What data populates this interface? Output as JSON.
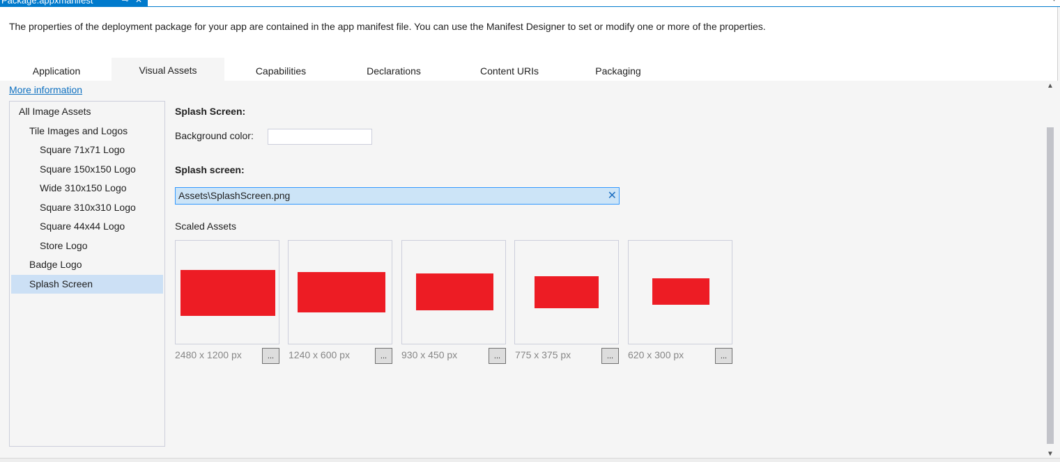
{
  "document_tab": {
    "title": "Package.appxmanifest",
    "pin_glyph": "⊸",
    "close_glyph": "✕"
  },
  "description": "The properties of the deployment package for your app are contained in the app manifest file. You can use the Manifest Designer to set or modify one or more of the properties.",
  "tabs": [
    {
      "label": "Application",
      "active": false
    },
    {
      "label": "Visual Assets",
      "active": true
    },
    {
      "label": "Capabilities",
      "active": false
    },
    {
      "label": "Declarations",
      "active": false
    },
    {
      "label": "Content URIs",
      "active": false
    },
    {
      "label": "Packaging",
      "active": false
    }
  ],
  "more_information": "More information",
  "tree": [
    {
      "label": "All Image Assets",
      "level": 0,
      "selected": false
    },
    {
      "label": "Tile Images and Logos",
      "level": 1,
      "selected": false
    },
    {
      "label": "Square 71x71 Logo",
      "level": 2,
      "selected": false
    },
    {
      "label": "Square 150x150 Logo",
      "level": 2,
      "selected": false
    },
    {
      "label": "Wide 310x150 Logo",
      "level": 2,
      "selected": false
    },
    {
      "label": "Square 310x310 Logo",
      "level": 2,
      "selected": false
    },
    {
      "label": "Square 44x44 Logo",
      "level": 2,
      "selected": false
    },
    {
      "label": "Store Logo",
      "level": 2,
      "selected": false
    },
    {
      "label": "Badge Logo",
      "level": 1,
      "selected": false
    },
    {
      "label": "Splash Screen",
      "level": 1,
      "selected": true
    }
  ],
  "splash": {
    "section_title": "Splash Screen:",
    "background_color_label": "Background color:",
    "background_color_value": "",
    "splash_screen_label": "Splash screen:",
    "path_value": "Assets\\SplashScreen.png",
    "clear_glyph": "✕",
    "scaled_assets_label": "Scaled Assets"
  },
  "scaled_assets": [
    {
      "size": "2480 x 1200 px",
      "button": "..."
    },
    {
      "size": "1240 x 600 px",
      "button": "..."
    },
    {
      "size": "930 x 450 px",
      "button": "..."
    },
    {
      "size": "775 x 375 px",
      "button": "..."
    },
    {
      "size": "620 x 300 px",
      "button": "..."
    }
  ],
  "colors": {
    "accent": "#007acc",
    "asset_fill": "#ed1c24",
    "selection": "#cce0f5",
    "link": "#0e70c0"
  },
  "icons": {
    "scroll_up": "▲",
    "scroll_down": "▼",
    "overflow": "▾"
  }
}
